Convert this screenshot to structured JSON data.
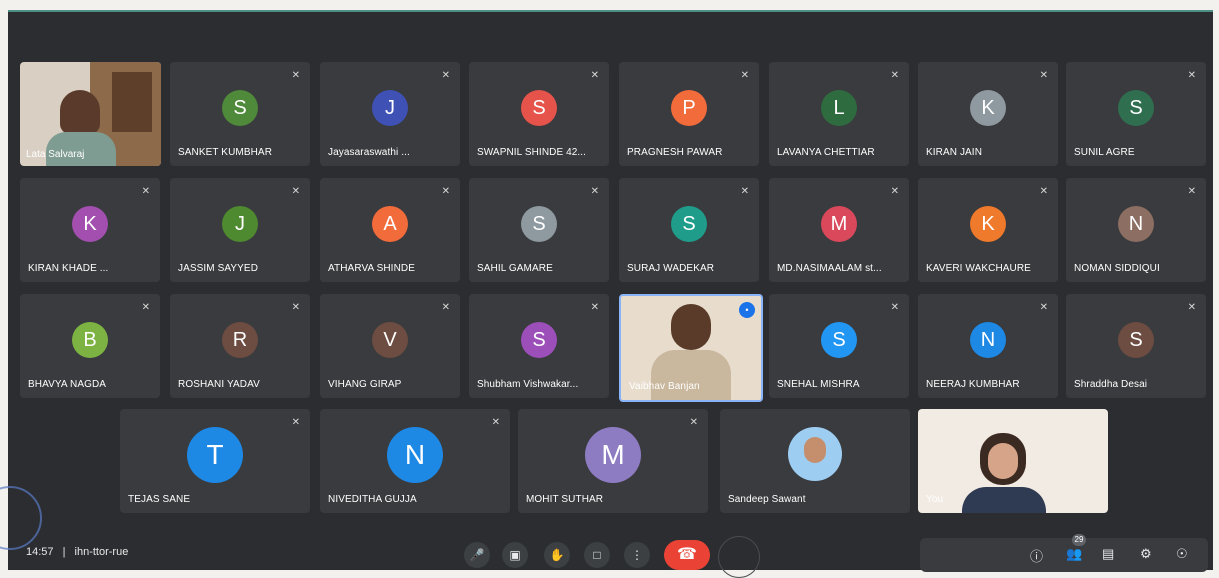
{
  "participants": [
    {
      "name": "Sanket Kumbhar",
      "display": "SANKET KUMBHAR",
      "initial": "S",
      "color": "#4f8a3a"
    },
    {
      "name": "Jayasaraswathi",
      "display": "Jayasaraswathi ...",
      "initial": "J",
      "color": "#3f51b5"
    },
    {
      "name": "Swapnil Shinde",
      "display": "SWAPNIL SHINDE 42...",
      "initial": "S",
      "color": "#e5534b"
    },
    {
      "name": "Pragnesh Pawar",
      "display": "PRAGNESH PAWAR",
      "initial": "P",
      "color": "#f26b3a"
    },
    {
      "name": "Lavanya Chettiar",
      "display": "LAVANYA CHETTIAR",
      "initial": "L",
      "color": "#2e6b3e"
    },
    {
      "name": "Kiran Jain",
      "display": "KIRAN JAIN",
      "initial": "K",
      "color": "#8e9aa0"
    },
    {
      "name": "Sunil Agre",
      "display": "SUNIL AGRE",
      "initial": "S",
      "color": "#2f6f4f"
    },
    {
      "name": "Kiran Khade",
      "display": "KIRAN KHADE ...",
      "initial": "K",
      "color": "#a24fb0"
    },
    {
      "name": "Jassim Sayyed",
      "display": "JASSIM SAYYED",
      "initial": "J",
      "color": "#4e8a2f"
    },
    {
      "name": "Atharva Shinde",
      "display": "ATHARVA SHINDE",
      "initial": "A",
      "color": "#f26b3a"
    },
    {
      "name": "Sahil Gamare",
      "display": "SAHIL GAMARE",
      "initial": "S",
      "color": "#8e9aa0"
    },
    {
      "name": "Suraj Wadekar",
      "display": "SURAJ WADEKAR",
      "initial": "S",
      "color": "#1f9d8a"
    },
    {
      "name": "Md Nasim Aalam",
      "display": "MD.NASIMAALAM st...",
      "initial": "M",
      "color": "#d9485b"
    },
    {
      "name": "Kaveri Wakchaure",
      "display": "KAVERI WAKCHAURE",
      "initial": "K",
      "color": "#f07a2b"
    },
    {
      "name": "Noman Siddiqui",
      "display": "NOMAN SIDDIQUI",
      "initial": "N",
      "color": "#8d6e63"
    },
    {
      "name": "Bhavya Nagda",
      "display": "BHAVYA NAGDA",
      "initial": "B",
      "color": "#7cb342"
    },
    {
      "name": "Roshani Yadav",
      "display": "ROSHANI YADAV",
      "initial": "R",
      "color": "#6d4c41"
    },
    {
      "name": "Vihang Girap",
      "display": "VIHANG GIRAP",
      "initial": "V",
      "color": "#6d4c41"
    },
    {
      "name": "Shubham Vishwakarma",
      "display": "Shubham Vishwakar...",
      "initial": "S",
      "color": "#9c4fb8"
    },
    {
      "name": "Vaibhav Banjan",
      "display": "Vaibhav Banjan",
      "initial": "",
      "color": ""
    },
    {
      "name": "Snehal Mishra",
      "display": "SNEHAL MISHRA",
      "initial": "S",
      "color": "#2196f3"
    },
    {
      "name": "Neeraj Kumbhar",
      "display": "NEERAJ KUMBHAR",
      "initial": "N",
      "color": "#1e88e5"
    },
    {
      "name": "Shraddha Desai",
      "display": "Shraddha Desai",
      "initial": "S",
      "color": "#6d4c41"
    },
    {
      "name": "Tejas Sane",
      "display": "TEJAS SANE",
      "initial": "T",
      "color": "#1e88e5"
    },
    {
      "name": "Niveditha Gujja",
      "display": "NIVEDITHA GUJJA",
      "initial": "N",
      "color": "#1e88e5"
    },
    {
      "name": "Mohit Suthar",
      "display": "MOHIT SUTHAR",
      "initial": "M",
      "color": "#8e7cc3"
    },
    {
      "name": "Sandeep Sawant",
      "display": "Sandeep Sawant",
      "initial": "",
      "color": ""
    },
    {
      "name": "You",
      "display": "You",
      "initial": "",
      "color": ""
    }
  ],
  "host": {
    "display": "Lata Salvaraj"
  },
  "bottombar": {
    "time": "14:57",
    "separator": "|",
    "meeting_code": "ihn-ttor-rue",
    "participant_count": "29"
  },
  "colors": {
    "active_speaker": "#8ab4f8",
    "end_call": "#ea4335"
  }
}
